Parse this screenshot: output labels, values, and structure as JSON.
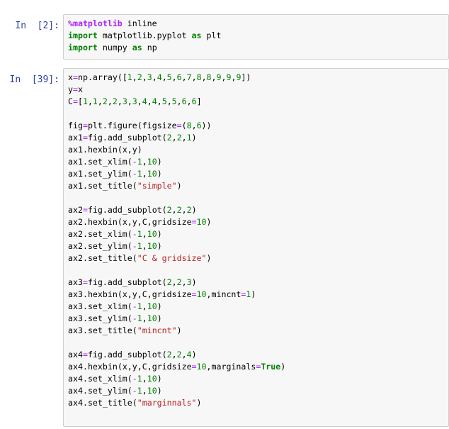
{
  "cells": [
    {
      "prompt": "In  [2]:",
      "lines": [
        "%matplotlib inline",
        "import matplotlib.pyplot as plt",
        "import numpy as np"
      ]
    },
    {
      "prompt": "In  [39]:",
      "lines": [
        "x=np.array([1,2,3,4,5,6,7,8,8,9,9,9])",
        "y=x",
        "C=[1,1,2,2,3,3,4,4,5,5,6,6]",
        "",
        "fig=plt.figure(figsize=(8,6))",
        "ax1=fig.add_subplot(2,2,1)",
        "ax1.hexbin(x,y)",
        "ax1.set_xlim(-1,10)",
        "ax1.set_ylim(-1,10)",
        "ax1.set_title(\"simple\")",
        "",
        "ax2=fig.add_subplot(2,2,2)",
        "ax2.hexbin(x,y,C,gridsize=10)",
        "ax2.set_xlim(-1,10)",
        "ax2.set_ylim(-1,10)",
        "ax2.set_title(\"C & gridsize\")",
        "",
        "ax3=fig.add_subplot(2,2,3)",
        "ax3.hexbin(x,y,C,gridsize=10,mincnt=1)",
        "ax3.set_xlim(-1,10)",
        "ax3.set_ylim(-1,10)",
        "ax3.set_title(\"mincnt\")",
        "",
        "ax4=fig.add_subplot(2,2,4)",
        "ax4.hexbin(x,y,C,gridsize=10,marginals=True)",
        "ax4.set_xlim(-1,10)",
        "ax4.set_ylim(-1,10)",
        "ax4.set_title(\"marginnals\")"
      ]
    }
  ],
  "colors": {
    "prompt": "#303f9f",
    "keyword": "#008000",
    "string": "#ba2121",
    "magic": "#aa22ff",
    "cell_background": "#f7f7f7",
    "cell_border": "#cfcfcf"
  }
}
